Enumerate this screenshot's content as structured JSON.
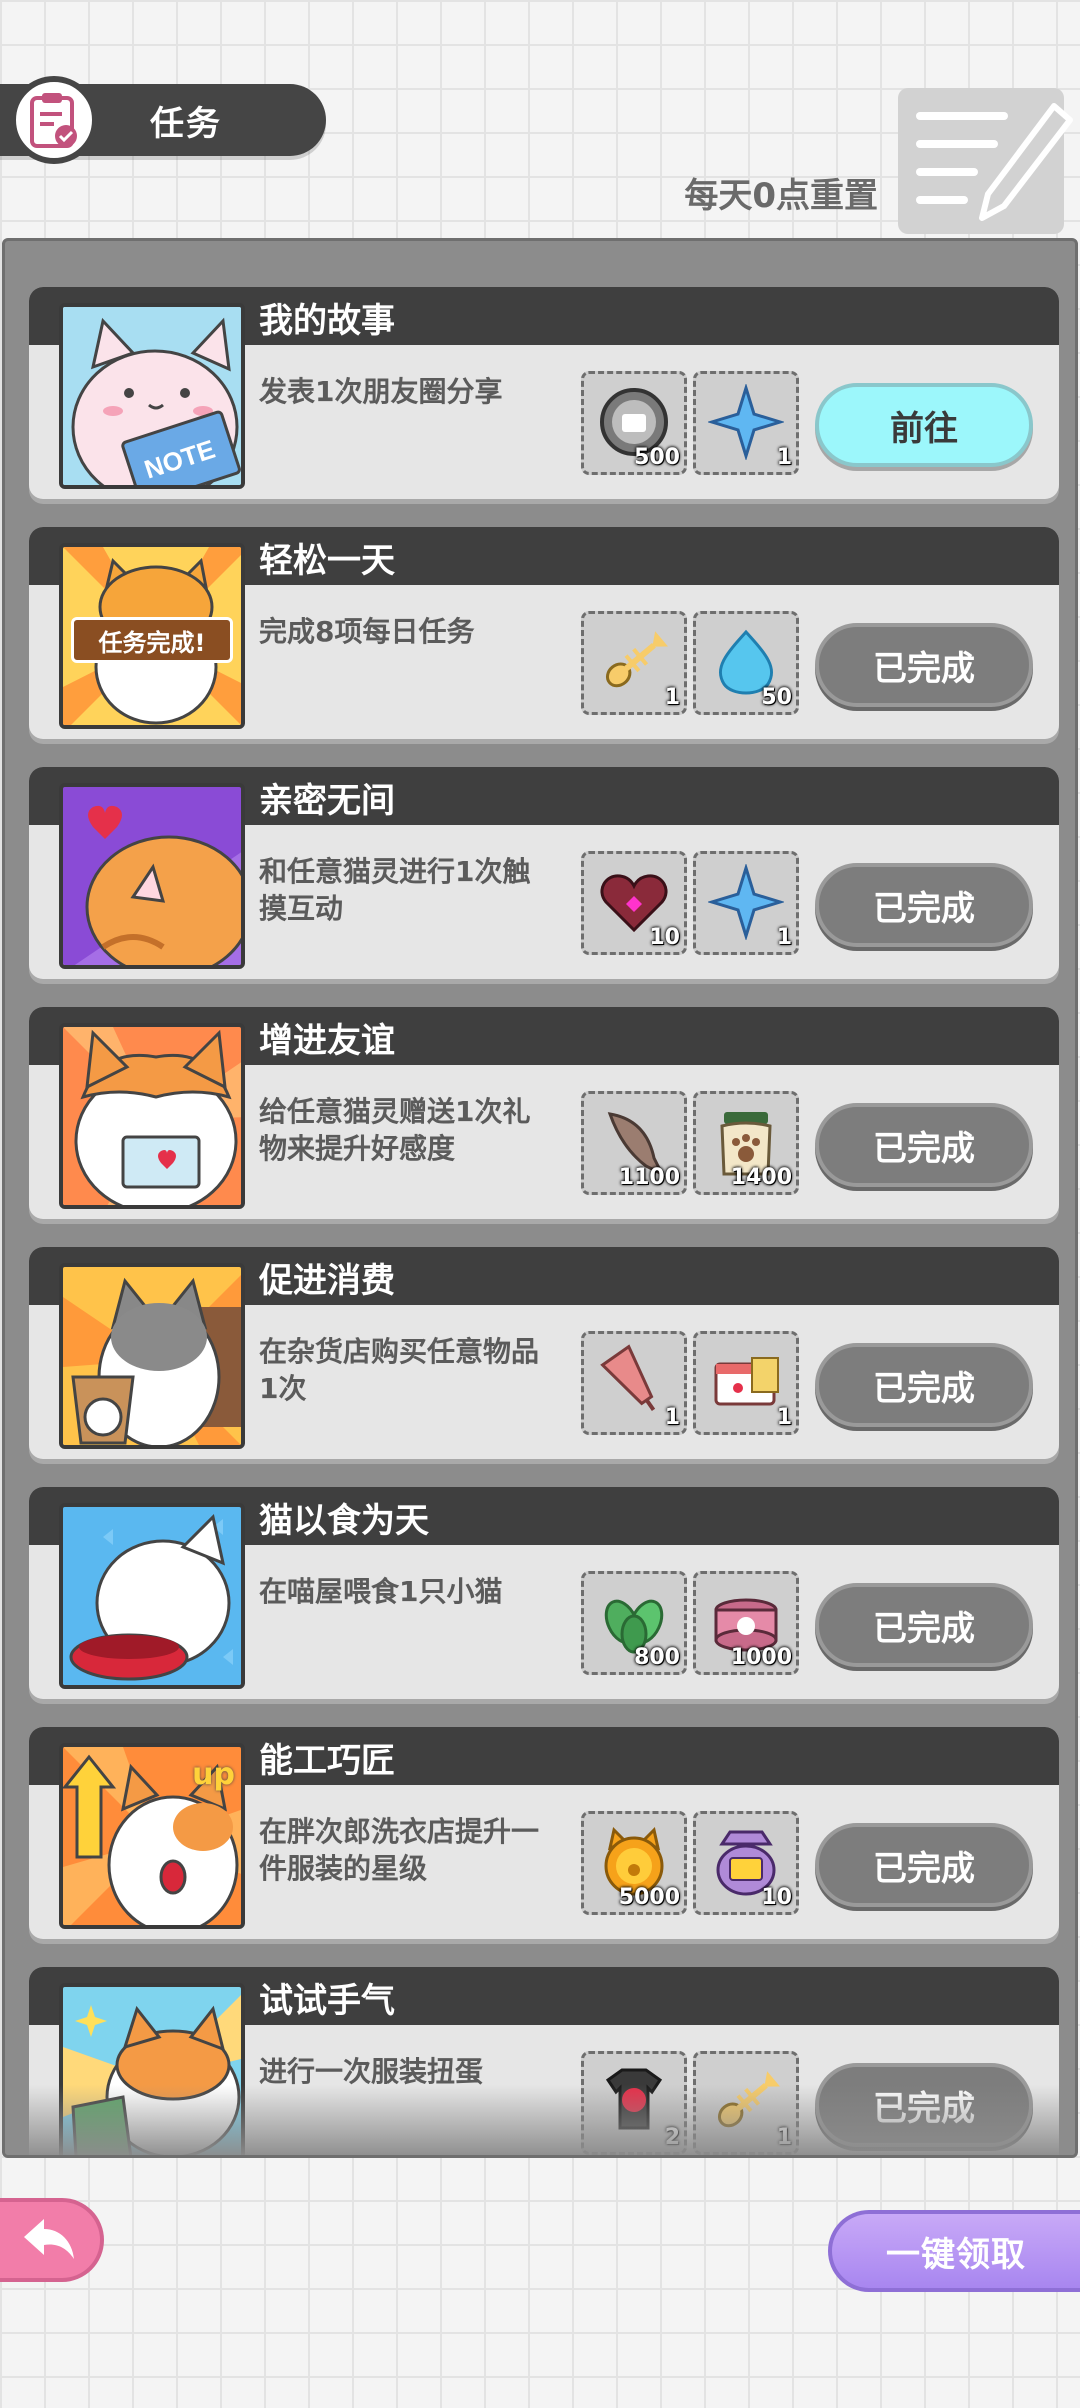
{
  "header": {
    "title": "任务",
    "title_icon": "clipboard-check-icon",
    "reset_note": "每天0点重置"
  },
  "tasks": [
    {
      "title": "我的故事",
      "desc": "发表1次朋友圈分享",
      "art": "cat-note-art",
      "rewards": [
        {
          "icon": "photo-coin-icon",
          "qty": "500"
        },
        {
          "icon": "blue-star-icon",
          "qty": "1"
        }
      ],
      "button": "前往",
      "state": "go"
    },
    {
      "title": "轻松一天",
      "desc": "完成8项每日任务",
      "art": "cat-task-complete-art",
      "art_text": "任务完成!",
      "rewards": [
        {
          "icon": "fishbone-icon",
          "qty": "1"
        },
        {
          "icon": "blue-drop-icon",
          "qty": "50"
        }
      ],
      "button": "已完成",
      "state": "done"
    },
    {
      "title": "亲密无间",
      "desc": "和任意猫灵进行1次触摸互动",
      "art": "orange-cat-heart-art",
      "rewards": [
        {
          "icon": "heart-box-icon",
          "qty": "10"
        },
        {
          "icon": "blue-star-icon",
          "qty": "1"
        }
      ],
      "button": "已完成",
      "state": "done"
    },
    {
      "title": "增进友谊",
      "desc": "给任意猫灵赠送1次礼物来提升好感度",
      "art": "cat-letter-art",
      "rewards": [
        {
          "icon": "fish-icon",
          "qty": "1100"
        },
        {
          "icon": "paw-bag-icon",
          "qty": "1400"
        }
      ],
      "button": "已完成",
      "state": "done"
    },
    {
      "title": "促进消费",
      "desc": "在杂货店购买任意物品1次",
      "art": "cat-shopping-art",
      "rewards": [
        {
          "icon": "umbrella-icon",
          "qty": "1"
        },
        {
          "icon": "envelope-card-icon",
          "qty": "1"
        }
      ],
      "button": "已完成",
      "state": "done"
    },
    {
      "title": "猫以食为天",
      "desc": "在喵屋喂食1只小猫",
      "art": "cat-food-bowl-art",
      "rewards": [
        {
          "icon": "catnip-leaf-icon",
          "qty": "800"
        },
        {
          "icon": "cat-can-icon",
          "qty": "1000"
        }
      ],
      "button": "已完成",
      "state": "done"
    },
    {
      "title": "能工巧匠",
      "desc": "在胖次郎洗衣店提升一件服装的星级",
      "art": "cat-upgrade-art",
      "art_text": "up",
      "rewards": [
        {
          "icon": "gold-cat-coin-icon",
          "qty": "5000"
        },
        {
          "icon": "shirt-token-icon",
          "qty": "10"
        }
      ],
      "button": "已完成",
      "state": "done"
    },
    {
      "title": "试试手气",
      "desc": "进行一次服装扭蛋",
      "art": "cat-gacha-art",
      "rewards": [
        {
          "icon": "gacha-shirt-icon",
          "qty": "2"
        },
        {
          "icon": "fishbone-icon",
          "qty": "1"
        }
      ],
      "button": "已完成",
      "state": "done"
    }
  ],
  "footer": {
    "back_icon": "back-arrow-icon",
    "claim_all": "一键领取"
  },
  "colors": {
    "header_dark": "#454545",
    "go_button": "#9cf7fb",
    "done_button": "#7d7d7d",
    "back_button": "#f27da9",
    "claim_button": "#a886f0"
  }
}
